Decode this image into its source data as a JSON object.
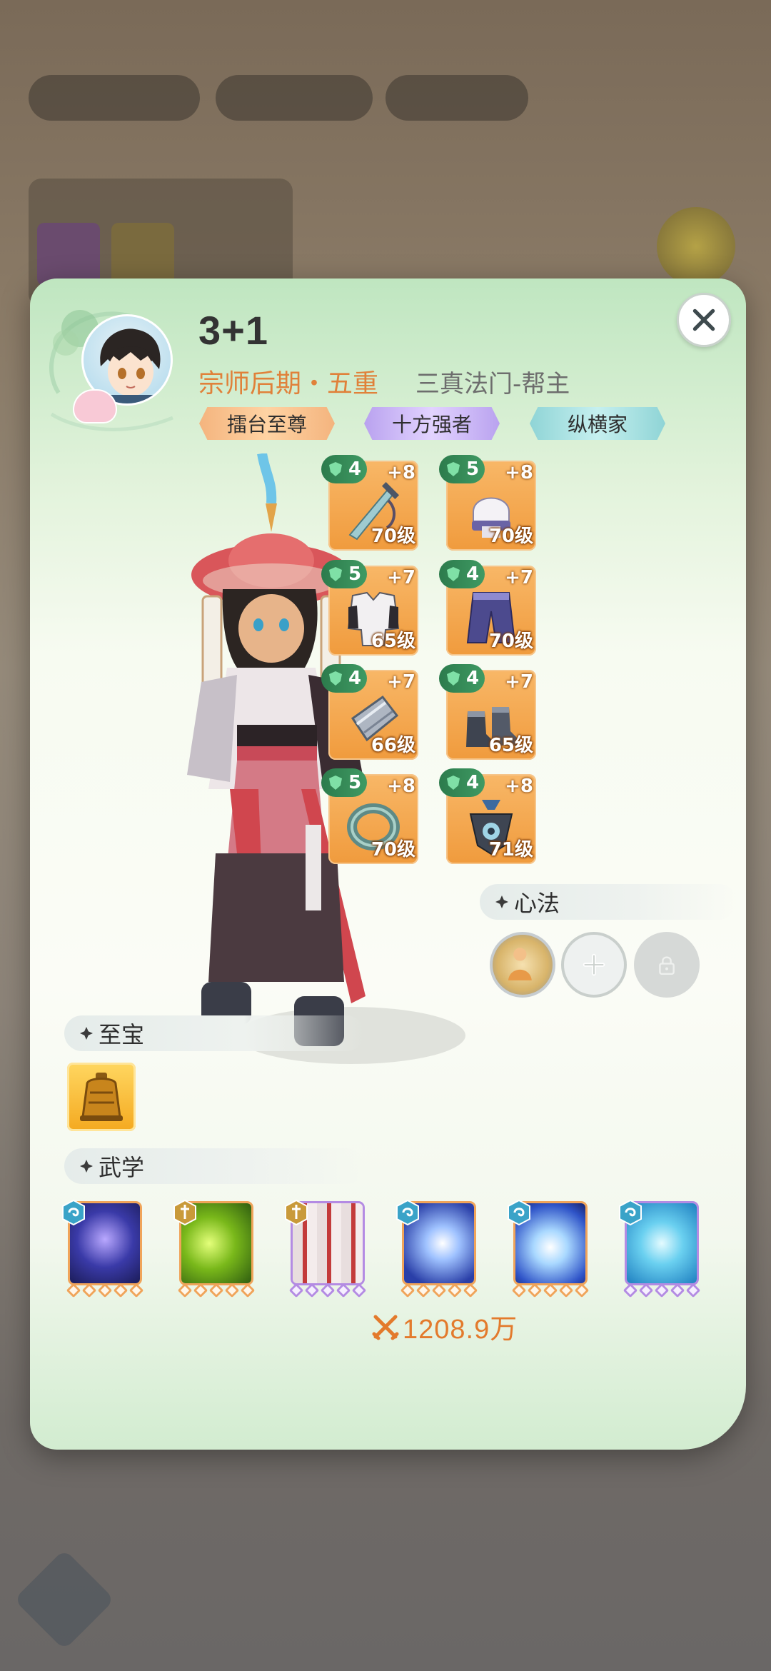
{
  "player": {
    "name": "3+1",
    "rank": "宗师后期・五重",
    "sect": "三真法门-帮主",
    "badges": [
      "擂台至尊",
      "十方强者",
      "纵横家"
    ]
  },
  "equipment": [
    {
      "stars": "4",
      "plus": "+8",
      "level": "70级",
      "icon": "sword-icon"
    },
    {
      "stars": "5",
      "plus": "+8",
      "level": "70级",
      "icon": "hat-icon"
    },
    {
      "stars": "5",
      "plus": "+7",
      "level": "65级",
      "icon": "robe-icon"
    },
    {
      "stars": "4",
      "plus": "+7",
      "level": "70级",
      "icon": "pants-icon"
    },
    {
      "stars": "4",
      "plus": "+7",
      "level": "66级",
      "icon": "bracer-icon"
    },
    {
      "stars": "4",
      "plus": "+7",
      "level": "65级",
      "icon": "boots-icon"
    },
    {
      "stars": "5",
      "plus": "+8",
      "level": "70级",
      "icon": "ring-icon"
    },
    {
      "stars": "4",
      "plus": "+8",
      "level": "71级",
      "icon": "pendant-icon"
    }
  ],
  "sections": {
    "xinfa": "心法",
    "treasure": "至宝",
    "martial": "武学"
  },
  "xinfa_slots": [
    {
      "state": "equipped",
      "icon": "xinfa-monk-icon"
    },
    {
      "state": "empty",
      "icon": "plus-icon"
    },
    {
      "state": "locked",
      "icon": "lock-icon"
    }
  ],
  "treasure": {
    "icon": "golden-bell-icon"
  },
  "skills": [
    {
      "type": "taiji-icon",
      "art": "starry-orb-skill-icon",
      "frame": "orange"
    },
    {
      "type": "sword-type-icon",
      "art": "green-lightning-skill-icon",
      "frame": "orange"
    },
    {
      "type": "sword-type-icon",
      "art": "red-swords-skill-icon",
      "frame": "purple"
    },
    {
      "type": "taiji-icon",
      "art": "ice-claw-skill-icon",
      "frame": "orange"
    },
    {
      "type": "taiji-icon",
      "art": "lightning-palm-skill-icon",
      "frame": "orange"
    },
    {
      "type": "taiji-icon",
      "art": "water-fist-skill-icon",
      "frame": "purple"
    }
  ],
  "combat_power": "1208.9万",
  "colors": {
    "accent_orange": "#e37a2c",
    "star_green": "#2c7b4c",
    "equip_orange": "#f09b3d",
    "frame_purple": "#b48be3"
  }
}
